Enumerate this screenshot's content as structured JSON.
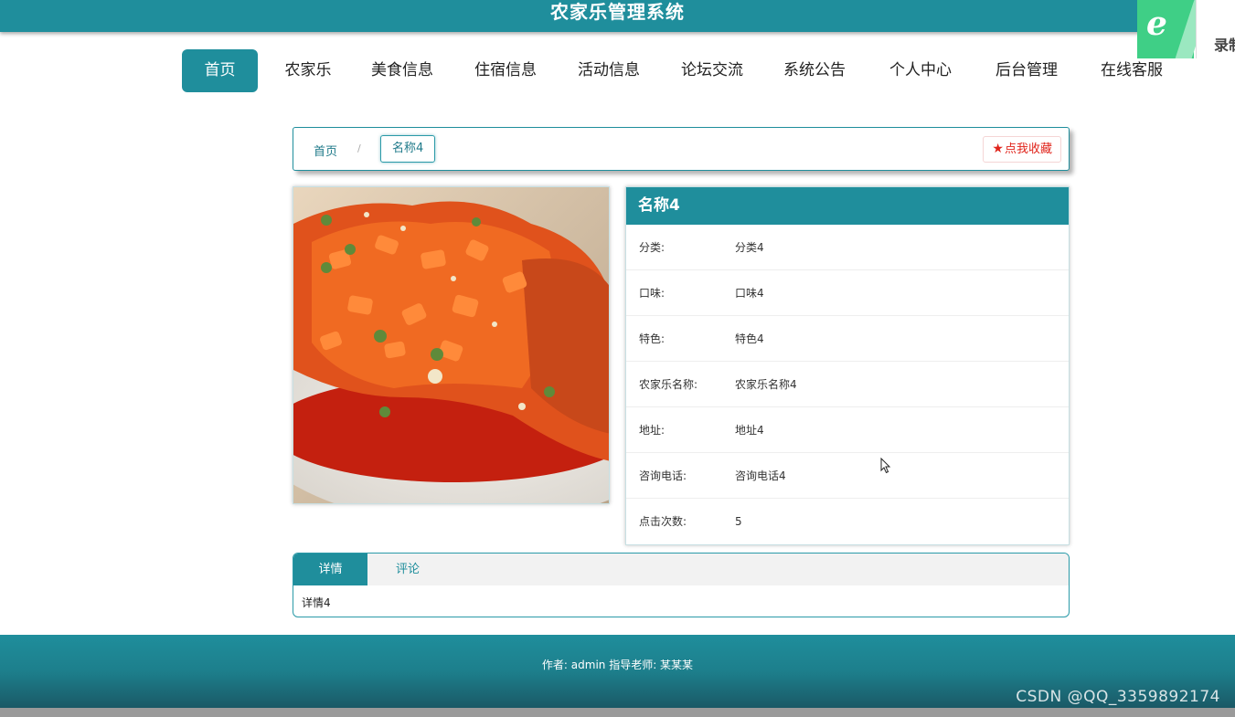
{
  "header": {
    "title": "农家乐管理系统"
  },
  "recorder_badge": {
    "text": "录制"
  },
  "nav": {
    "items": [
      {
        "label": "首页",
        "active": true
      },
      {
        "label": "农家乐"
      },
      {
        "label": "美食信息"
      },
      {
        "label": "住宿信息"
      },
      {
        "label": "活动信息"
      },
      {
        "label": "论坛交流"
      },
      {
        "label": "系统公告"
      },
      {
        "label": "个人中心"
      },
      {
        "label": "后台管理"
      },
      {
        "label": "在线客服"
      }
    ]
  },
  "breadcrumb": {
    "home": "首页",
    "separator": "/",
    "current": "名称4"
  },
  "favorite_button": {
    "label": "点我收藏"
  },
  "detail": {
    "name": "名称4",
    "rows": [
      {
        "key": "分类:",
        "value": "分类4"
      },
      {
        "key": "口味:",
        "value": "口味4"
      },
      {
        "key": "特色:",
        "value": "特色4"
      },
      {
        "key": "农家乐名称:",
        "value": "农家乐名称4"
      },
      {
        "key": "地址:",
        "value": "地址4"
      },
      {
        "key": "咨询电话:",
        "value": "咨询电话4"
      },
      {
        "key": "点击次数:",
        "value": "5"
      }
    ]
  },
  "tabs": {
    "items": [
      {
        "label": "详情",
        "active": true
      },
      {
        "label": "评论"
      }
    ],
    "content": "详情4"
  },
  "footer": {
    "text": "作者: admin 指导老师: 某某某"
  },
  "watermark": "CSDN @QQ_3359892174",
  "colors": {
    "primary": "#1f8e9c",
    "favorite": "#e0241b"
  }
}
